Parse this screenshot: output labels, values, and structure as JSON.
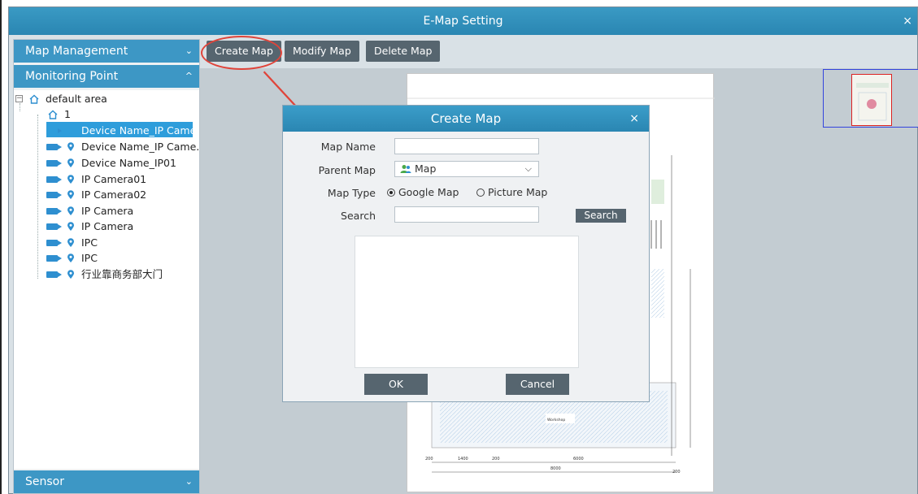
{
  "window": {
    "title": "E-Map Setting",
    "close": "×"
  },
  "left_panel": {
    "map_management": {
      "label": "Map Management",
      "chevron": "⌄"
    },
    "monitoring_point": {
      "label": "Monitoring Point",
      "chevron": "^"
    },
    "sensor": {
      "label": "Sensor",
      "chevron": "⌄"
    },
    "tree": {
      "root": "default area",
      "node": "1",
      "items": [
        "Device Name_IP Came...",
        "Device Name_IP Came...",
        "Device Name_IP01",
        "IP Camera01",
        "IP Camera02",
        "IP Camera",
        "IP Camera",
        "IPC",
        "IPC",
        "行业靠商务部大门"
      ]
    }
  },
  "toolbar": {
    "create": "Create Map",
    "modify": "Modify Map",
    "delete": "Delete Map"
  },
  "dialog": {
    "title": "Create Map",
    "close": "×",
    "map_name_label": "Map Name",
    "map_name_value": "",
    "parent_map_label": "Parent Map",
    "parent_map_value": "Map",
    "map_type_label": "Map Type",
    "map_type_options": [
      "Google Map",
      "Picture Map"
    ],
    "map_type_selected": "Google Map",
    "search_label": "Search",
    "search_value": "",
    "search_button": "Search",
    "ok": "OK",
    "cancel": "Cancel"
  },
  "colors": {
    "titlebar": "#2a86b2",
    "section": "#3d97c5",
    "button": "#56656f",
    "selected": "#2e9ddb",
    "highlight_circle": "#e0443a"
  }
}
